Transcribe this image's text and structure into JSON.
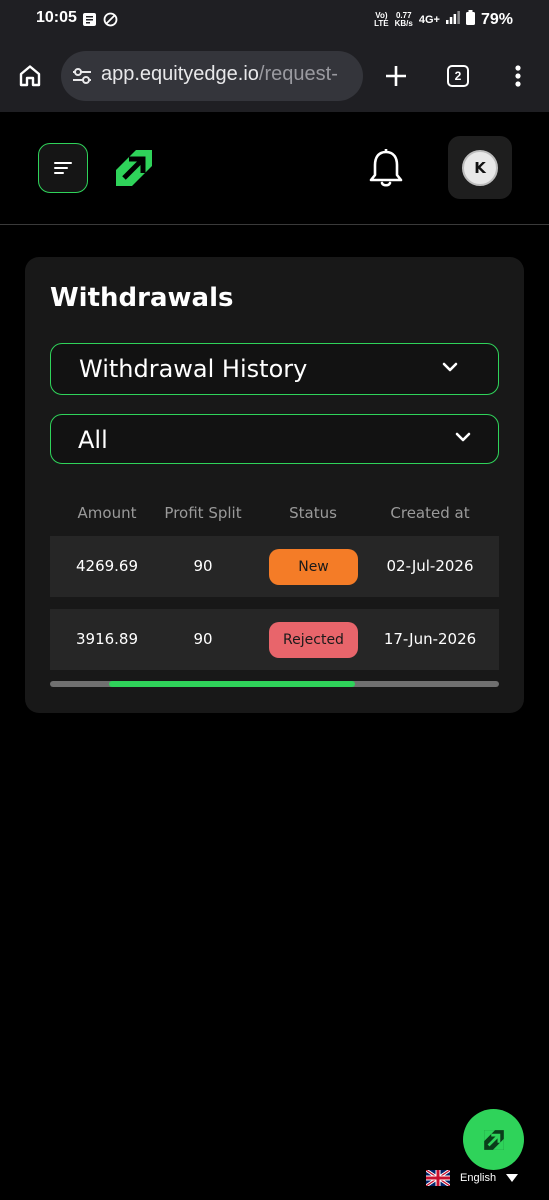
{
  "status_bar": {
    "time": "10:05",
    "volte": "Vo))\nLTE",
    "speed": "0.77\nKB/s",
    "network": "4G+",
    "battery": "79%"
  },
  "browser": {
    "url_host": "app.equityedge.io",
    "url_path": "/request-",
    "tab_count": "2"
  },
  "header": {
    "avatar_initial": "K",
    "accent": "#2fd35a"
  },
  "card": {
    "title": "Withdrawals",
    "select_view": "Withdrawal History",
    "select_filter": "All",
    "columns": [
      "Amount",
      "Profit Split",
      "Status",
      "Created at"
    ],
    "rows": [
      {
        "amount": "4269.69",
        "profit_split": "90",
        "status": "New",
        "created_at": "02-Jul-2026",
        "status_color": "#f47c27"
      },
      {
        "amount": "3916.89",
        "profit_split": "90",
        "status": "Rejected",
        "created_at": "17-Jun-2026",
        "status_color": "#e8656b"
      }
    ],
    "scroll_position": 0.29
  },
  "language": {
    "label": "English"
  }
}
